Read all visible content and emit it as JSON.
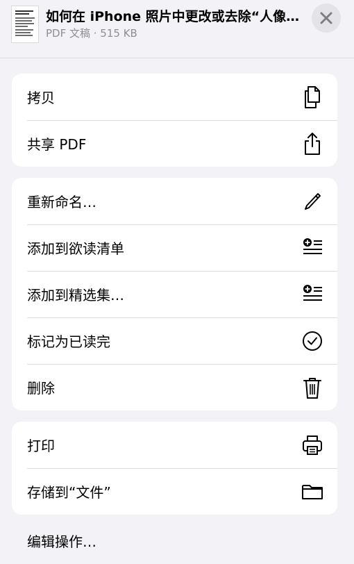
{
  "header": {
    "title": "如何在 iPhone 照片中更改或去除“人像…",
    "subtitle": "PDF 文稿 · 515 KB"
  },
  "groups": [
    {
      "items": [
        {
          "label": "拷贝",
          "icon": "copy-icon"
        },
        {
          "label": "共享 PDF",
          "icon": "share-icon"
        }
      ]
    },
    {
      "items": [
        {
          "label": "重新命名…",
          "icon": "pencil-icon"
        },
        {
          "label": "添加到欲读清单",
          "icon": "reading-list-add-icon"
        },
        {
          "label": "添加到精选集…",
          "icon": "collection-add-icon"
        },
        {
          "label": "标记为已读完",
          "icon": "checkmark-circle-icon"
        },
        {
          "label": "删除",
          "icon": "trash-icon"
        }
      ]
    },
    {
      "items": [
        {
          "label": "打印",
          "icon": "printer-icon"
        },
        {
          "label": "存储到“文件”",
          "icon": "folder-icon"
        }
      ]
    }
  ],
  "footer": {
    "edit_actions": "编辑操作…"
  },
  "colors": {
    "background": "#f2f2f7",
    "card": "#ffffff",
    "separator": "#dcdce0",
    "secondary_text": "#8e8e93",
    "close_button_bg": "#e3e3e8"
  }
}
